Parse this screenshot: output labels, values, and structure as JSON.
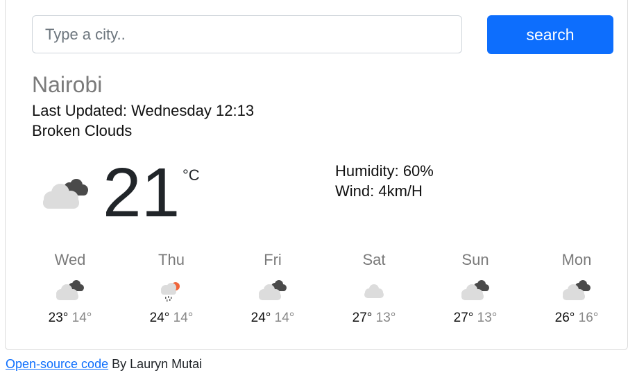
{
  "search": {
    "placeholder": "Type a city..",
    "button_label": "search"
  },
  "current": {
    "city": "Nairobi",
    "last_updated_label": "Last Updated:",
    "last_updated_value": "Wednesday 12:13",
    "description": "Broken Clouds",
    "icon": "broken-clouds-icon",
    "temperature": "21",
    "unit": "°C",
    "humidity_label": "Humidity:",
    "humidity_value": "60%",
    "wind_label": "Wind:",
    "wind_value": "4km/H"
  },
  "forecast": [
    {
      "day": "Wed",
      "icon": "broken-clouds-icon",
      "max": "23°",
      "min": "14°"
    },
    {
      "day": "Thu",
      "icon": "rain-icon",
      "max": "24°",
      "min": "14°"
    },
    {
      "day": "Fri",
      "icon": "broken-clouds-icon",
      "max": "24°",
      "min": "14°"
    },
    {
      "day": "Sat",
      "icon": "clouds-icon",
      "max": "27°",
      "min": "13°"
    },
    {
      "day": "Sun",
      "icon": "broken-clouds-icon",
      "max": "27°",
      "min": "13°"
    },
    {
      "day": "Mon",
      "icon": "broken-clouds-icon",
      "max": "26°",
      "min": "16°"
    }
  ],
  "footer": {
    "link_text": "Open-source code",
    "byline": "By Lauryn Mutai"
  },
  "colors": {
    "accent": "#0d6efd",
    "muted": "#7a7a7a"
  }
}
